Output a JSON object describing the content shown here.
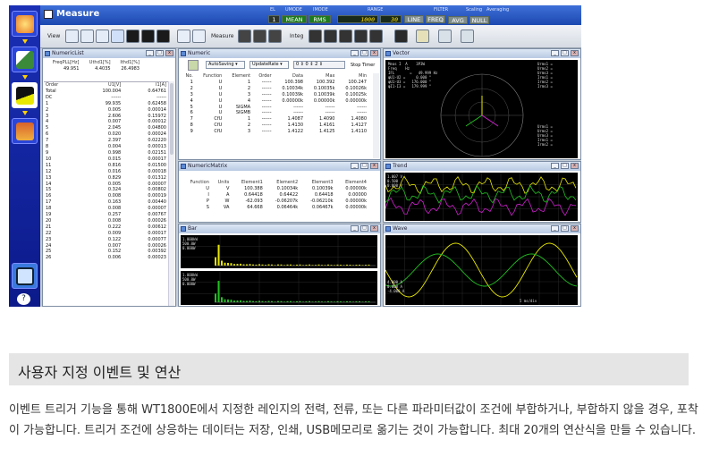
{
  "app": {
    "title": "Measure",
    "status_labels": {
      "el": "EL",
      "umode": "UMODE",
      "imode": "IMODE",
      "range": "RANGE",
      "filter": "FILTER",
      "scaling": "Scaling",
      "averaging": "Averaging"
    },
    "status": {
      "el_val": "1",
      "umode_val": "MEAN",
      "imode_val": "RMS",
      "range_u": "1000",
      "range_i": "30",
      "line": "LINE",
      "freq": "FREQ",
      "avg": "AVG",
      "null": "NULL"
    },
    "toolbar": {
      "view": "View",
      "measure": "Measure",
      "integ": "Integ"
    }
  },
  "numeric_list": {
    "title": "NumericList",
    "summary_headers": [
      "FreqPLL[Hz]",
      "Uthd1[%]",
      "Ithd1[%]"
    ],
    "summary_values": [
      "49.951",
      "4.4035",
      "26.4983"
    ],
    "columns": [
      "Order",
      "U1[V]",
      "I1[A]"
    ],
    "rows": [
      [
        "Total",
        "100.004",
        "0.64761"
      ],
      [
        "DC",
        "------",
        "------"
      ],
      [
        "1",
        "99.935",
        "0.62458"
      ],
      [
        "2",
        "0.005",
        "0.00014"
      ],
      [
        "3",
        "2.606",
        "0.15972"
      ],
      [
        "4",
        "0.007",
        "0.00012"
      ],
      [
        "5",
        "2.045",
        "0.04800"
      ],
      [
        "6",
        "0.020",
        "0.00024"
      ],
      [
        "7",
        "2.397",
        "0.02220"
      ],
      [
        "8",
        "0.004",
        "0.00013"
      ],
      [
        "9",
        "0.998",
        "0.02151"
      ],
      [
        "10",
        "0.015",
        "0.00017"
      ],
      [
        "11",
        "0.816",
        "0.01500"
      ],
      [
        "12",
        "0.016",
        "0.00018"
      ],
      [
        "13",
        "0.829",
        "0.01312"
      ],
      [
        "14",
        "0.005",
        "0.00007"
      ],
      [
        "15",
        "0.324",
        "0.00802"
      ],
      [
        "16",
        "0.008",
        "0.00019"
      ],
      [
        "17",
        "0.163",
        "0.00440"
      ],
      [
        "18",
        "0.008",
        "0.00007"
      ],
      [
        "19",
        "0.257",
        "0.00767"
      ],
      [
        "20",
        "0.008",
        "0.00026"
      ],
      [
        "21",
        "0.222",
        "0.00612"
      ],
      [
        "22",
        "0.009",
        "0.00017"
      ],
      [
        "23",
        "0.122",
        "0.00077"
      ],
      [
        "24",
        "0.007",
        "0.00026"
      ],
      [
        "25",
        "0.152",
        "0.00392"
      ],
      [
        "26",
        "0.006",
        "0.00023"
      ]
    ]
  },
  "numeric": {
    "title": "Numeric",
    "autosaving": "AutoSaving",
    "update_rate": "UpdateRate",
    "stop_timer": "Stop Timer",
    "columns": [
      "No.",
      "Function",
      "Element",
      "Order",
      "Data",
      "Max",
      "Min"
    ],
    "rows": [
      [
        "1",
        "U",
        "1",
        "------",
        "100.398",
        "100.392",
        "100.247"
      ],
      [
        "2",
        "U",
        "2",
        "------",
        "0.10034k",
        "0.10035k",
        "0.10026k"
      ],
      [
        "3",
        "U",
        "3",
        "------",
        "0.10039k",
        "0.10039k",
        "0.10025k"
      ],
      [
        "4",
        "U",
        "4",
        "------",
        "0.00000k",
        "0.00000k",
        "0.00000k"
      ],
      [
        "5",
        "U",
        "SIGMA",
        "------",
        "------",
        "------",
        "------"
      ],
      [
        "6",
        "U",
        "SIGMB",
        "------",
        "------",
        "------",
        "------"
      ],
      [
        "7",
        "CfU",
        "1",
        "------",
        "1.4087",
        "1.4090",
        "1.4080"
      ],
      [
        "8",
        "CfU",
        "2",
        "------",
        "1.4130",
        "1.4161",
        "1.4127"
      ],
      [
        "9",
        "CfU",
        "3",
        "------",
        "1.4122",
        "1.4125",
        "1.4110"
      ]
    ]
  },
  "numeric_matrix": {
    "title": "NumericMatrix",
    "columns": [
      "Function",
      "Units",
      "Element1",
      "Element2",
      "Element3",
      "Element4"
    ],
    "rows": [
      [
        "U",
        "V",
        "100.388",
        "0.10034k",
        "0.10039k",
        "0.00000k"
      ],
      [
        "I",
        "A",
        "0.64418",
        "0.64422",
        "0.64418",
        "0.00000"
      ],
      [
        "P",
        "W",
        "-62.093",
        "-0.06207k",
        "-0.06210k",
        "0.00000k"
      ],
      [
        "S",
        "VA",
        "64.668",
        "0.06464k",
        "0.06467k",
        "0.00000k"
      ]
    ]
  },
  "vector": {
    "title": "Vector",
    "left_readout": "Meas I  A    3P3W\nFreq    Hz\nIFL       =   49.999 Hz\nφU1-U2 =     0.000 °\nφU1-U3 =   176.000 °\nφI1-I3 =   179.999 °",
    "right_top": "Urms1 =\nUrms2 =\nUrms3 =\nIrms1 =\nIrms2 =\nIrms3 =",
    "right_bottom": "Urms1 =\nUrms2 =\nUrms3 =\nIrms1 =\nIrms2 ="
  },
  "trend": {
    "title": "Trend",
    "readout": "1.007 V\n0.500\n0.000 V"
  },
  "bar": {
    "title": "Bar",
    "readout_a": "1.000kW\n500.0W\n0.000W",
    "readout_b": "1.000kW\n500.0W\n0.000W",
    "x_ticks": [
      "0",
      "10",
      "20",
      "30",
      "40"
    ]
  },
  "wave": {
    "title": "Wave",
    "readout": "4.000 A\n0.000 A\n-4.000 A",
    "xlabel": "5 ms/div"
  },
  "section_title": "사용자 지정 이벤트 및 연산",
  "body_text": "이벤트 트리거 기능을 통해 WT1800E에서 지정한 레인지의 전력, 전류, 또는 다른 파라미터값이 조건에 부합하거나, 부합하지 않을 경우, 포착이 가능합니다. 트리거 조건에 상응하는 데이터는 저장, 인쇄, USB메모리로 옮기는 것이 가능합니다. 최대 20개의 연산식을 만들 수 있습니다.",
  "colors": {
    "accent": "#1c49b0",
    "trace_yellow": "#e8e800",
    "trace_green": "#22c022",
    "trace_magenta": "#d020d0"
  }
}
